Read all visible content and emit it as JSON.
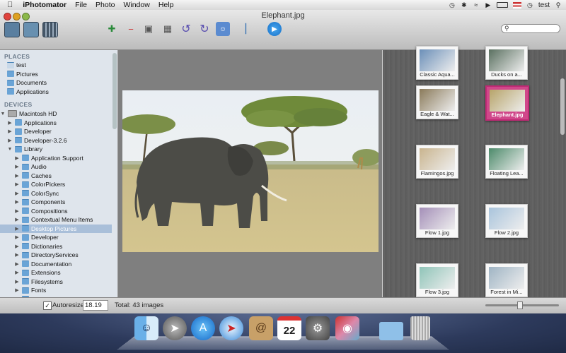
{
  "menubar": {
    "apple": "",
    "app_name": "iPhotomator",
    "menus": [
      "File",
      "Photo",
      "Window",
      "Help"
    ],
    "user": "test"
  },
  "window": {
    "title": "Elephant.jpg",
    "search_placeholder": ""
  },
  "sidebar": {
    "places_header": "PLACES",
    "places": [
      "test",
      "Pictures",
      "Documents",
      "Applications"
    ],
    "devices_header": "DEVICES",
    "device": "Macintosh HD",
    "items": [
      {
        "label": "Applications",
        "indent": 1
      },
      {
        "label": "Developer",
        "indent": 1
      },
      {
        "label": "Developer-3.2.6",
        "indent": 1
      },
      {
        "label": "Library",
        "indent": 1,
        "expanded": true
      },
      {
        "label": "Application Support",
        "indent": 2
      },
      {
        "label": "Audio",
        "indent": 2
      },
      {
        "label": "Caches",
        "indent": 2
      },
      {
        "label": "ColorPickers",
        "indent": 2
      },
      {
        "label": "ColorSync",
        "indent": 2
      },
      {
        "label": "Components",
        "indent": 2
      },
      {
        "label": "Compositions",
        "indent": 2
      },
      {
        "label": "Contextual Menu Items",
        "indent": 2
      },
      {
        "label": "Desktop Pictures",
        "indent": 2,
        "selected": true
      },
      {
        "label": "Developer",
        "indent": 2
      },
      {
        "label": "Dictionaries",
        "indent": 2
      },
      {
        "label": "DirectoryServices",
        "indent": 2
      },
      {
        "label": "Documentation",
        "indent": 2
      },
      {
        "label": "Extensions",
        "indent": 2
      },
      {
        "label": "Filesystems",
        "indent": 2
      },
      {
        "label": "Fonts",
        "indent": 2
      },
      {
        "label": "Frameworks",
        "indent": 2
      }
    ]
  },
  "grid": {
    "thumbs": [
      {
        "caption": "Classic Aqua...",
        "color": "#6b8fb8"
      },
      {
        "caption": "Ducks on a...",
        "color": "#5a7060"
      },
      {
        "caption": "Eagle & Wat...",
        "color": "#8a7a5a"
      },
      {
        "caption": "Elephant.jpg",
        "color": "#b7a46a",
        "selected": true
      },
      {
        "caption": "Flamingos.jpg",
        "color": "#c9b48e"
      },
      {
        "caption": "Floating Lea...",
        "color": "#4c8a6a"
      },
      {
        "caption": "Flow 1.jpg",
        "color": "#a48fb8"
      },
      {
        "caption": "Flow 2.jpg",
        "color": "#a9c4dc"
      },
      {
        "caption": "Flow 3.jpg",
        "color": "#8fc4b8"
      },
      {
        "caption": "Forest in Mi...",
        "color": "#9fb4c4"
      }
    ]
  },
  "status": {
    "autoresize_label": "Autoresize",
    "autoresize_checked": true,
    "size_value": "18.19",
    "total": "Total: 43 images"
  },
  "dock": {
    "calendar_day": "22",
    "apps": [
      "finder-icon",
      "launchpad-icon",
      "app-store-icon",
      "safari-icon",
      "contacts-icon",
      "calendar-icon",
      "system-preferences-icon",
      "iphotomator-icon",
      "downloads-folder-icon",
      "trash-icon"
    ]
  }
}
